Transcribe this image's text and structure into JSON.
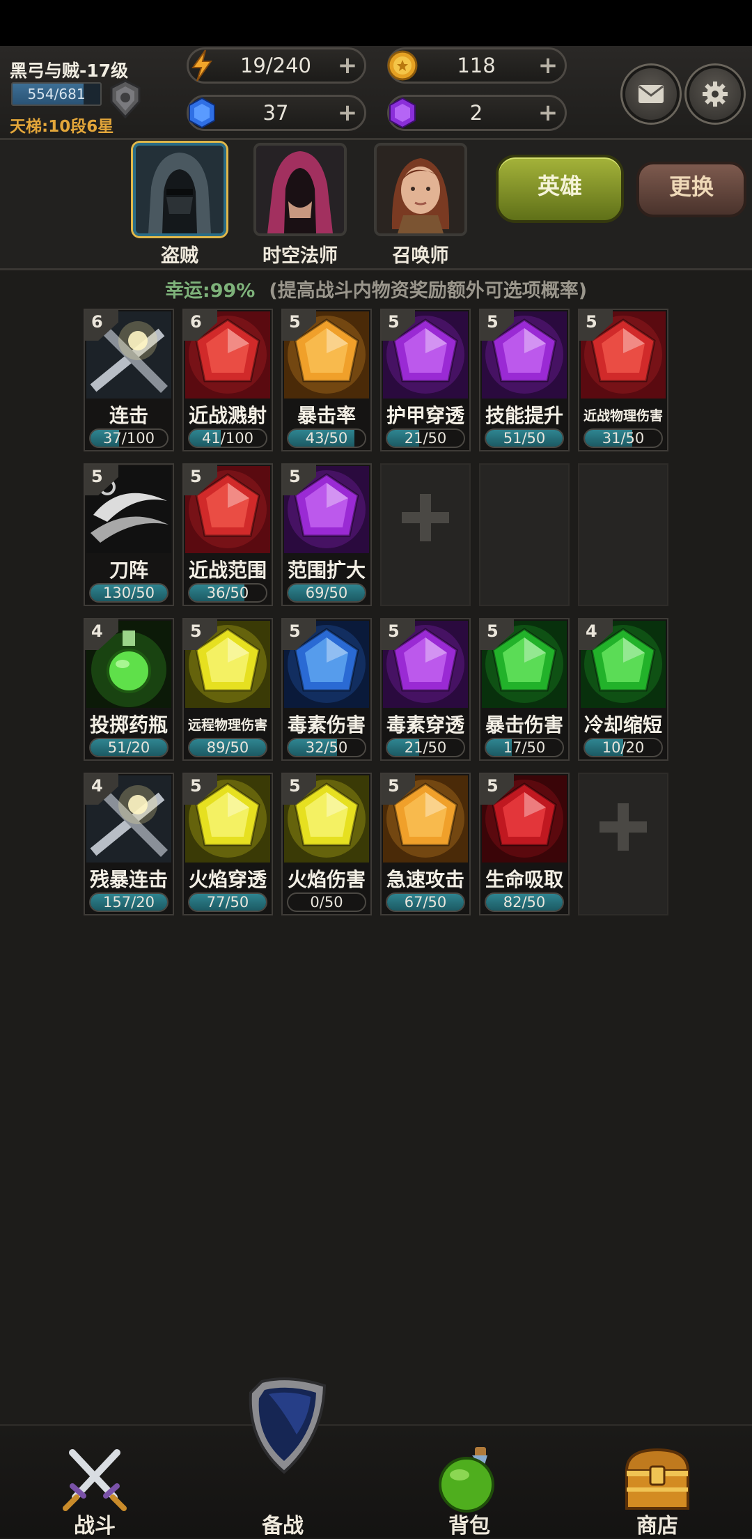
{
  "player": {
    "name": "黑弓与贼-17级",
    "xp": "554/681",
    "xp_fraction": 0.81,
    "ladder": "天梯:10段6星"
  },
  "resources": {
    "energy": "19/240",
    "gold": "118",
    "blue_gem": "37",
    "purple_gem": "2"
  },
  "icons": {
    "mail": "mail-icon",
    "settings": "gear-icon"
  },
  "heroes": [
    {
      "label": "盗贼",
      "selected": true
    },
    {
      "label": "时空法师",
      "selected": false
    },
    {
      "label": "召唤师",
      "selected": false
    }
  ],
  "buttons": {
    "hero": "英雄",
    "change": "更换"
  },
  "luck": {
    "value": "幸运:99%",
    "desc": "(提高战斗内物资奖励额外可选项概率)"
  },
  "gems": [
    {
      "level": "6",
      "name": "连击",
      "progress": "37/100",
      "fraction": 0.37,
      "art": "sword"
    },
    {
      "level": "6",
      "name": "近战溅射",
      "progress": "41/100",
      "fraction": 0.41,
      "art": "red"
    },
    {
      "level": "5",
      "name": "暴击率",
      "progress": "43/50",
      "fraction": 0.86,
      "art": "orange"
    },
    {
      "level": "5",
      "name": "护甲穿透",
      "progress": "21/50",
      "fraction": 0.42,
      "art": "purple"
    },
    {
      "level": "5",
      "name": "技能提升",
      "progress": "51/50",
      "fraction": 1.0,
      "art": "purple"
    },
    {
      "level": "5",
      "name": "近战物理伤害",
      "progress": "31/50",
      "fraction": 0.62,
      "art": "red"
    },
    {
      "level": "5",
      "name": "刀阵",
      "progress": "130/50",
      "fraction": 1.0,
      "art": "blade"
    },
    {
      "level": "5",
      "name": "近战范围",
      "progress": "36/50",
      "fraction": 0.72,
      "art": "red"
    },
    {
      "level": "5",
      "name": "范围扩大",
      "progress": "69/50",
      "fraction": 1.0,
      "art": "purple"
    },
    {
      "empty": true,
      "plus": true
    },
    {
      "empty": true
    },
    {
      "empty": true
    },
    {
      "level": "4",
      "name": "投掷药瓶",
      "progress": "51/20",
      "fraction": 1.0,
      "art": "potion"
    },
    {
      "level": "5",
      "name": "远程物理伤害",
      "progress": "89/50",
      "fraction": 1.0,
      "art": "yellow"
    },
    {
      "level": "5",
      "name": "毒素伤害",
      "progress": "32/50",
      "fraction": 0.64,
      "art": "blue"
    },
    {
      "level": "5",
      "name": "毒素穿透",
      "progress": "21/50",
      "fraction": 0.42,
      "art": "purple"
    },
    {
      "level": "5",
      "name": "暴击伤害",
      "progress": "17/50",
      "fraction": 0.34,
      "art": "green"
    },
    {
      "level": "4",
      "name": "冷却缩短",
      "progress": "10/20",
      "fraction": 0.5,
      "art": "green"
    },
    {
      "level": "4",
      "name": "残暴连击",
      "progress": "157/20",
      "fraction": 1.0,
      "art": "sword"
    },
    {
      "level": "5",
      "name": "火焰穿透",
      "progress": "77/50",
      "fraction": 1.0,
      "art": "yellow"
    },
    {
      "level": "5",
      "name": "火焰伤害",
      "progress": "0/50",
      "fraction": 0.0,
      "art": "yellow"
    },
    {
      "level": "5",
      "name": "急速攻击",
      "progress": "67/50",
      "fraction": 1.0,
      "art": "orange"
    },
    {
      "level": "5",
      "name": "生命吸取",
      "progress": "82/50",
      "fraction": 1.0,
      "art": "crimson"
    },
    {
      "empty": true,
      "plus": true
    }
  ],
  "nav": [
    {
      "label": "战斗",
      "icon": "crossed-swords-icon"
    },
    {
      "label": "备战",
      "icon": "shield-icon",
      "active": true
    },
    {
      "label": "背包",
      "icon": "potion-icon"
    },
    {
      "label": "商店",
      "icon": "treasure-chest-icon"
    }
  ]
}
